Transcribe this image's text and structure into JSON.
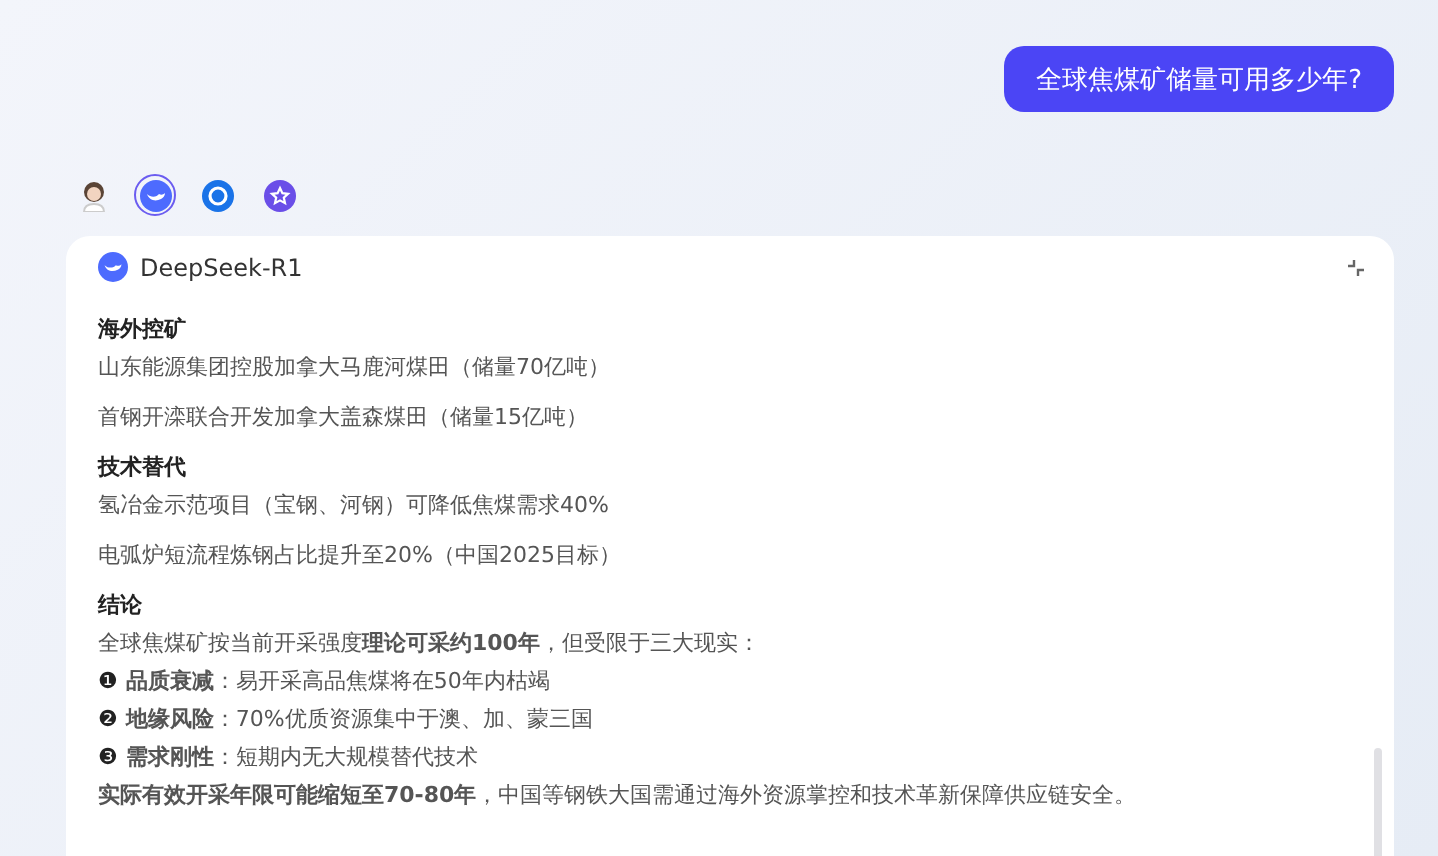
{
  "user_message": "全球焦煤矿储量可用多少年?",
  "models": [
    {
      "kind": "avatar",
      "selected": false
    },
    {
      "kind": "deepseek",
      "selected": true
    },
    {
      "kind": "ring",
      "selected": false
    },
    {
      "kind": "star",
      "selected": false
    }
  ],
  "answer": {
    "title": "DeepSeek-R1",
    "blocks": [
      {
        "kind": "heading",
        "text": "海外控矿"
      },
      {
        "kind": "paragraph",
        "text": "山东能源集团控股加拿大马鹿河煤田（储量70亿吨）"
      },
      {
        "kind": "paragraph",
        "text": "首钢开滦联合开发加拿大盖森煤田（储量15亿吨）"
      },
      {
        "kind": "heading",
        "text": "技术替代"
      },
      {
        "kind": "paragraph",
        "text": "氢冶金示范项目（宝钢、河钢）可降低焦煤需求40%"
      },
      {
        "kind": "paragraph",
        "text": "电弧炉短流程炼钢占比提升至20%（中国2025目标）"
      },
      {
        "kind": "heading",
        "text": "结论"
      },
      {
        "kind": "line",
        "text": "全球焦煤矿按当前开采强度**理论可采约100年**，但受限于三大现实："
      },
      {
        "kind": "bullet",
        "marker": "❶",
        "text": "**品质衰减**：易开采高品焦煤将在50年内枯竭"
      },
      {
        "kind": "bullet",
        "marker": "❷",
        "text": "**地缘风险**：70%优质资源集中于澳、加、蒙三国"
      },
      {
        "kind": "bullet",
        "marker": "❸",
        "text": "**需求刚性**：短期内无大规模替代技术"
      },
      {
        "kind": "line",
        "text": "**实际有效开采年限可能缩短至70-80年**，中国等钢铁大国需通过海外资源掌控和技术革新保障供应链安全。"
      }
    ]
  }
}
